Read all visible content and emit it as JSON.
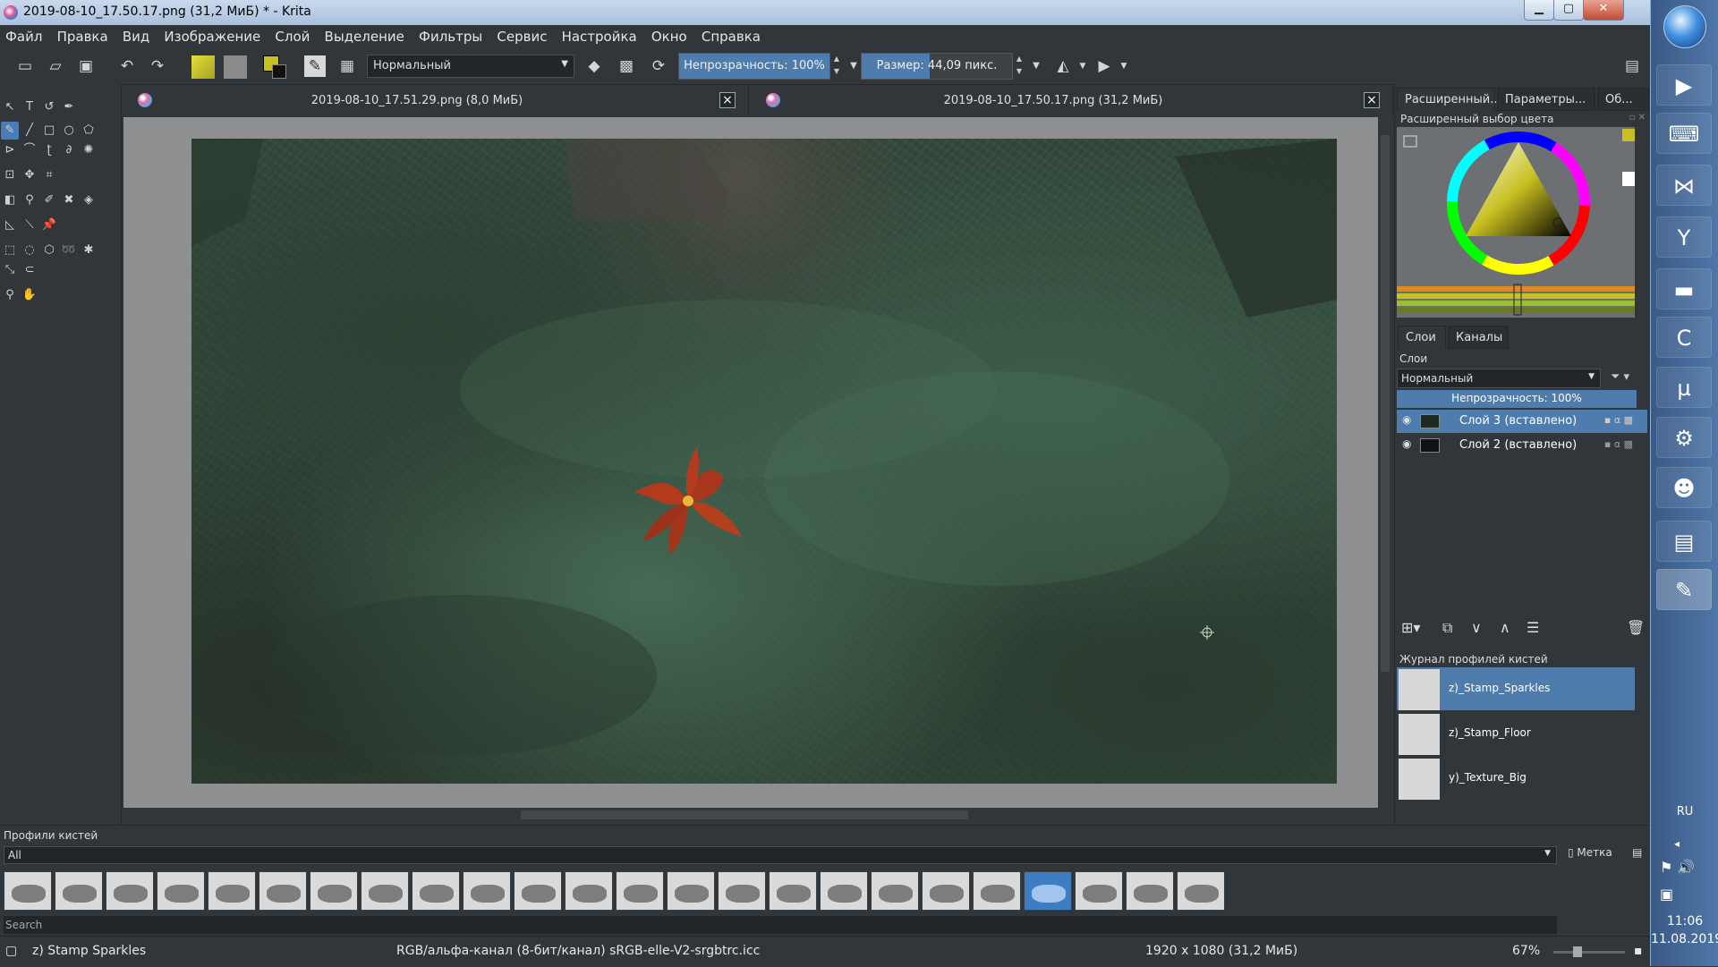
{
  "window": {
    "title": "2019-08-10_17.50.17.png (31,2 МиБ) * - Krita",
    "minimize": "▁",
    "maximize": "▢",
    "close": "✕"
  },
  "menu": [
    "Файл",
    "Правка",
    "Вид",
    "Изображение",
    "Слой",
    "Выделение",
    "Фильтры",
    "Сервис",
    "Настройка",
    "Окно",
    "Справка"
  ],
  "toolbar": {
    "blend_mode": "Нормальный",
    "opacity": "Непрозрачность:  100%",
    "opacity_value": 100,
    "size": "Размер:  44,09 пикс.",
    "size_fill_fraction": 0.45
  },
  "documents": [
    {
      "label": "2019-08-10_17.51.29.png (8,0 МиБ)",
      "close": "×"
    },
    {
      "label": "2019-08-10_17.50.17.png (31,2 МиБ)",
      "close": "×"
    }
  ],
  "dock_tabs": [
    "Расширенный...",
    "Параметры...",
    "Об..."
  ],
  "color_selector": {
    "title": "Расширенный выбор цвета",
    "foreground": "#c8c020",
    "background": "#ffffff"
  },
  "layers_panel": {
    "tabs": [
      "Слои",
      "Каналы"
    ],
    "title": "Слои",
    "blend_mode": "Нормальный",
    "opacity": "Непрозрачность:  100%",
    "layers": [
      {
        "name": "Слой 3 (вставлено)",
        "selected": true
      },
      {
        "name": "Слой 2 (вставлено)",
        "selected": false
      }
    ]
  },
  "brush_history": {
    "title": "Журнал профилей кистей",
    "items": [
      {
        "name": "z)_Stamp_Sparkles",
        "selected": true
      },
      {
        "name": "z)_Stamp_Floor",
        "selected": false
      },
      {
        "name": "y)_Texture_Big",
        "selected": false
      }
    ]
  },
  "brush_presets": {
    "title": "Профили кистей",
    "filter": "All",
    "tag_label": "Метка",
    "search_placeholder": "Search",
    "selected_index": 20,
    "count": 24
  },
  "status": {
    "brush": "z) Stamp Sparkles",
    "color_model": "RGB/альфа-канал (8-бит/канал)  sRGB-elle-V2-srgbtrc.icc",
    "dimensions": "1920 x 1080 (31,2 МиБ)",
    "zoom": "67%"
  },
  "taskbar": {
    "language": "RU",
    "time": "11:06",
    "date": "11.08.2019"
  }
}
